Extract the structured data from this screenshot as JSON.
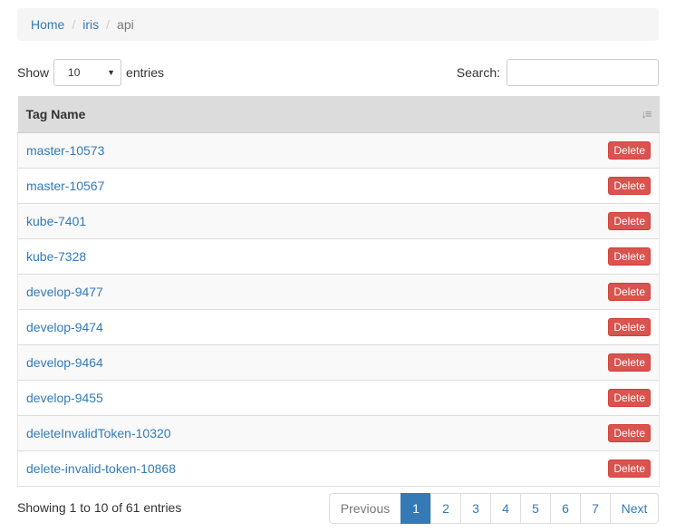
{
  "breadcrumb": {
    "items": [
      {
        "label": "Home"
      },
      {
        "label": "iris"
      }
    ],
    "current": "api",
    "separator": "/"
  },
  "length": {
    "prefix": "Show",
    "selected": "10",
    "suffix": "entries"
  },
  "search": {
    "label": "Search:",
    "value": ""
  },
  "table": {
    "header": "Tag Name",
    "delete_label": "Delete",
    "rows": [
      {
        "name": "master-10573"
      },
      {
        "name": "master-10567"
      },
      {
        "name": "kube-7401"
      },
      {
        "name": "kube-7328"
      },
      {
        "name": "develop-9477"
      },
      {
        "name": "develop-9474"
      },
      {
        "name": "develop-9464"
      },
      {
        "name": "develop-9455"
      },
      {
        "name": "deleteInvalidToken-10320"
      },
      {
        "name": "delete-invalid-token-10868"
      }
    ]
  },
  "info": "Showing 1 to 10 of 61 entries",
  "pagination": {
    "previous": "Previous",
    "next": "Next",
    "pages": [
      "1",
      "2",
      "3",
      "4",
      "5",
      "6",
      "7"
    ],
    "current": "1"
  },
  "colors": {
    "link": "#337ab7",
    "danger": "#d9534f",
    "header_bg": "#dcdcdc"
  },
  "icons": {
    "sort": "sort-descending-icon",
    "dropdown": "caret-down-icon"
  }
}
